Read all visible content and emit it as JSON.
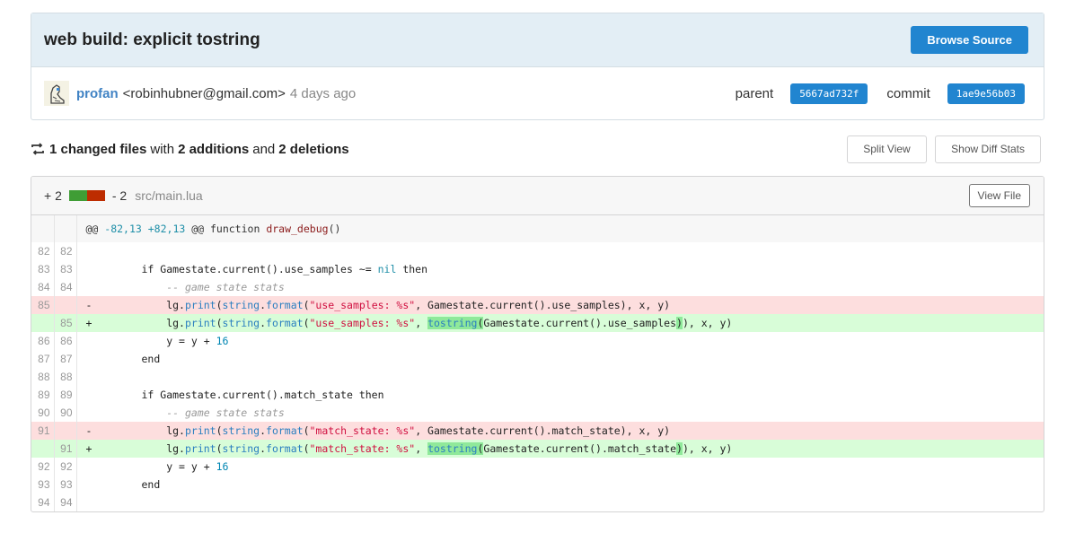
{
  "commit": {
    "title": "web build: explicit tostring",
    "browse_label": "Browse Source",
    "author_name": "profan",
    "author_email": "<robinhubner@gmail.com>",
    "time": "4 days ago",
    "parent_label": "parent",
    "parent_sha": "5667ad732f",
    "commit_label": "commit",
    "commit_sha": "1ae9e56b03"
  },
  "stats": {
    "icon": "diff-icon",
    "changed": "1 changed files",
    "with": "with",
    "additions": "2 additions",
    "and": "and",
    "deletions": "2 deletions",
    "split_view_label": "Split View",
    "diff_stats_label": "Show Diff Stats"
  },
  "file": {
    "additions": "+ 2",
    "deletions": "- 2",
    "path": "src/main.lua",
    "view_file_label": "View File",
    "add_color": "#3f9d35",
    "del_color": "#bd2c00"
  },
  "diff": {
    "hunk_header": {
      "prefix": "@@ ",
      "range": "-82,13 +82,13",
      "suffix": " @@ function ",
      "fn": "draw_debug",
      "tail": "()"
    },
    "lines": [
      {
        "type": "ctx",
        "old": "82",
        "new": "82",
        "sign": "",
        "code": ""
      },
      {
        "type": "ctx",
        "old": "83",
        "new": "83",
        "sign": "",
        "code": "        if Gamestate.current().use_samples ~= nil then"
      },
      {
        "type": "ctx",
        "old": "84",
        "new": "84",
        "sign": "",
        "code": "            -- game state stats"
      },
      {
        "type": "del",
        "old": "85",
        "new": "",
        "sign": "-",
        "code": "            lg.print(string.format(\"use_samples: %s\", Gamestate.current().use_samples), x, y)"
      },
      {
        "type": "add",
        "old": "",
        "new": "85",
        "sign": "+",
        "code": "            lg.print(string.format(\"use_samples: %s\", tostring(Gamestate.current().use_samples)), x, y)"
      },
      {
        "type": "ctx",
        "old": "86",
        "new": "86",
        "sign": "",
        "code": "            y = y + 16"
      },
      {
        "type": "ctx",
        "old": "87",
        "new": "87",
        "sign": "",
        "code": "        end"
      },
      {
        "type": "ctx",
        "old": "88",
        "new": "88",
        "sign": "",
        "code": ""
      },
      {
        "type": "ctx",
        "old": "89",
        "new": "89",
        "sign": "",
        "code": "        if Gamestate.current().match_state then"
      },
      {
        "type": "ctx",
        "old": "90",
        "new": "90",
        "sign": "",
        "code": "            -- game state stats"
      },
      {
        "type": "del",
        "old": "91",
        "new": "",
        "sign": "-",
        "code": "            lg.print(string.format(\"match_state: %s\", Gamestate.current().match_state), x, y)"
      },
      {
        "type": "add",
        "old": "",
        "new": "91",
        "sign": "+",
        "code": "            lg.print(string.format(\"match_state: %s\", tostring(Gamestate.current().match_state)), x, y)"
      },
      {
        "type": "ctx",
        "old": "92",
        "new": "92",
        "sign": "",
        "code": "            y = y + 16"
      },
      {
        "type": "ctx",
        "old": "93",
        "new": "93",
        "sign": "",
        "code": "        end"
      },
      {
        "type": "ctx",
        "old": "94",
        "new": "94",
        "sign": "",
        "code": ""
      }
    ]
  }
}
